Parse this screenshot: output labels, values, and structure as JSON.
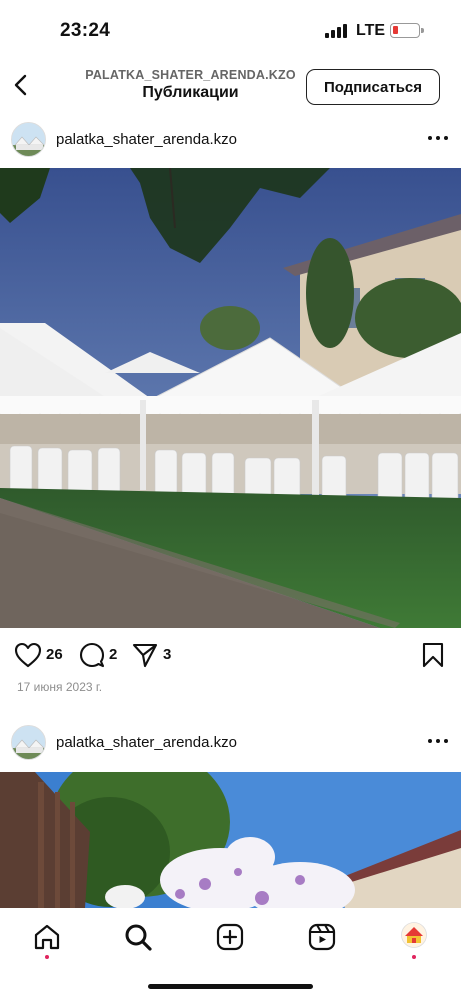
{
  "status_bar": {
    "time": "23:24",
    "network": "LTE",
    "battery_color": "#e53935"
  },
  "header": {
    "account_handle": "PALATKA_SHATER_ARENDA.KZO",
    "title": "Публикации",
    "subscribe_label": "Подписаться"
  },
  "posts": [
    {
      "username": "palatka_shater_arenda.kzo",
      "likes": "26",
      "comments": "2",
      "shares": "3",
      "date": "17 июня 2023 г."
    },
    {
      "username": "palatka_shater_arenda.kzo"
    }
  ],
  "icons": {
    "back": "chevron-left-icon",
    "more": "more-horizontal-icon",
    "like": "heart-icon",
    "comment": "comment-icon",
    "share": "send-icon",
    "save": "bookmark-icon",
    "nav": [
      "home-icon",
      "search-icon",
      "create-icon",
      "reels-icon",
      "profile-avatar"
    ]
  },
  "bottom_nav": {
    "notification_dot_color": "#e0245e"
  }
}
